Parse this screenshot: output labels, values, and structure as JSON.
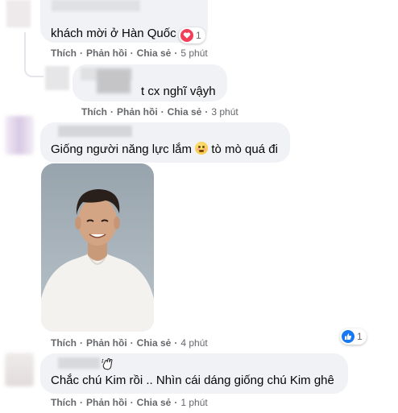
{
  "comments": [
    {
      "text": "khách mời ở Hàn Quốc",
      "reaction_count": "1",
      "actions": {
        "like": "Thích",
        "reply": "Phản hồi",
        "share": "Chia sẻ",
        "time": "5 phút"
      }
    },
    {
      "text": "t cx nghĩ vậyh",
      "actions": {
        "like": "Thích",
        "reply": "Phản hồi",
        "share": "Chia sẻ",
        "time": "3 phút"
      }
    },
    {
      "text_before": "Giống người năng lực lắm",
      "text_after": "tò mò quá đi",
      "reaction_count": "1",
      "actions": {
        "like": "Thích",
        "reply": "Phản hồi",
        "share": "Chia sẻ",
        "time": "4 phút"
      }
    },
    {
      "text": "Chắc chú Kim rồi .. Nhìn cái dáng giống chú Kim ghê",
      "actions": {
        "like": "Thích",
        "reply": "Phản hồi",
        "share": "Chia sẻ",
        "time": "1 phút"
      }
    }
  ],
  "colors": {
    "bubble": "#f0f2f5",
    "meta": "#65676b",
    "love": "#f33e58",
    "like": "#1877f2"
  },
  "icons": {
    "love": "heart-icon",
    "like": "thumbs-up-icon",
    "emoji": "flushed-face-emoji",
    "badge": "waving-hand-icon"
  }
}
